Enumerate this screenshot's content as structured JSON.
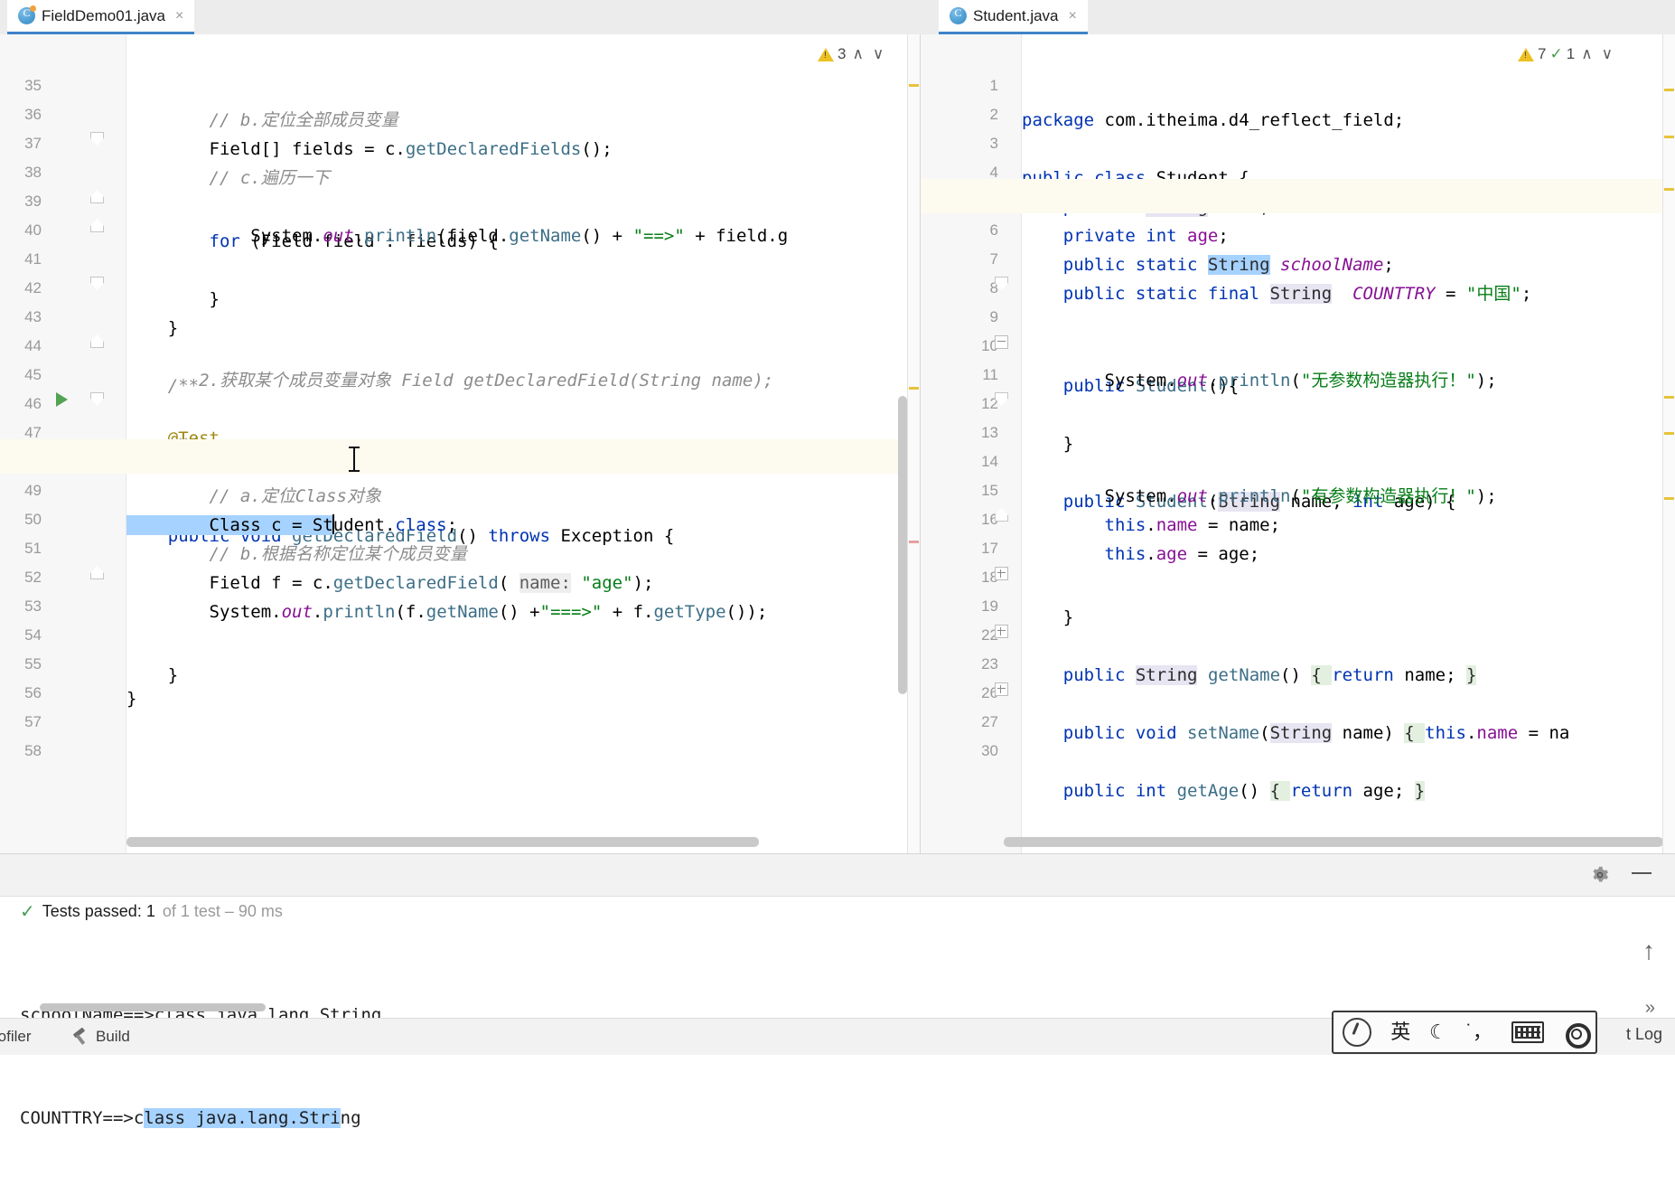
{
  "window": {
    "app": "IntelliJ IDEA"
  },
  "tabs": {
    "left": {
      "name": "FieldDemo01.java",
      "close": "×",
      "icon": "java-class-icon"
    },
    "right": {
      "name": "Student.java",
      "close": "×",
      "icon": "java-class-icon"
    }
  },
  "inspections": {
    "left": {
      "warning_count": "3",
      "prev": "∧",
      "next": "∨"
    },
    "right": {
      "warning_count": "7",
      "typo_count": "1",
      "prev": "∧",
      "next": "∨"
    }
  },
  "left_editor": {
    "file": "FieldDemo01.java",
    "lines": [
      {
        "n": "35",
        "text": "        // b.定位全部成员变量"
      },
      {
        "n": "36",
        "text": "        Field[] fields = c.getDeclaredFields();"
      },
      {
        "n": "37",
        "text": "        // c.遍历一下"
      },
      {
        "n": "38",
        "text": "        for (Field field : fields) {"
      },
      {
        "n": "39",
        "text": "            System.out.println(field.getName() + \"==>\" + field.g"
      },
      {
        "n": "40",
        "text": "        }"
      },
      {
        "n": "41",
        "text": "    }"
      },
      {
        "n": "42",
        "text": ""
      },
      {
        "n": "43",
        "text": "    /**"
      },
      {
        "n": "44",
        "text": "       2.获取某个成员变量对象 Field getDeclaredField(String name);"
      },
      {
        "n": "45",
        "text": "     */"
      },
      {
        "n": "46",
        "text": "    @Test"
      },
      {
        "n": "47",
        "text": "    public void getDeclaredField() throws Exception {"
      },
      {
        "n": "48",
        "text": "        // a.定位Class对象"
      },
      {
        "n": "49",
        "text": "        Class c = Student.class;"
      },
      {
        "n": "50",
        "text": "        // b.根据名称定位某个成员变量"
      },
      {
        "n": "51",
        "text": "        Field f = c.getDeclaredField( name: \"age\");"
      },
      {
        "n": "52",
        "text": "        System.out.println(f.getName() +\"===>\" + f.getType());"
      },
      {
        "n": "53",
        "text": "    }"
      },
      {
        "n": "54",
        "text": ""
      },
      {
        "n": "55",
        "text": "}"
      },
      {
        "n": "56",
        "text": ""
      },
      {
        "n": "57",
        "text": ""
      },
      {
        "n": "58",
        "text": ""
      }
    ]
  },
  "right_editor": {
    "file": "Student.java",
    "lines": [
      {
        "n": "1",
        "text": "package com.itheima.d4_reflect_field;"
      },
      {
        "n": "2",
        "text": ""
      },
      {
        "n": "3",
        "text": "public class Student {"
      },
      {
        "n": "4",
        "text": "    private String name;"
      },
      {
        "n": "5",
        "text": "    private int age;"
      },
      {
        "n": "6",
        "text": "    public static String schoolName;"
      },
      {
        "n": "7",
        "text": "    public static final String  COUNTTRY = \"中国\";"
      },
      {
        "n": "8",
        "text": ""
      },
      {
        "n": "9",
        "text": "    public Student(){"
      },
      {
        "n": "10",
        "text": "        System.out.println(\"无参数构造器执行！\");"
      },
      {
        "n": "11",
        "text": "    }"
      },
      {
        "n": "12",
        "text": ""
      },
      {
        "n": "13",
        "text": "    public Student(String name, int age) {"
      },
      {
        "n": "14",
        "text": "        System.out.println(\"有参数构造器执行！\");"
      },
      {
        "n": "15",
        "text": "        this.name = name;"
      },
      {
        "n": "16",
        "text": "        this.age = age;"
      },
      {
        "n": "17",
        "text": "    }"
      },
      {
        "n": "18",
        "text": ""
      },
      {
        "n": "19",
        "text": "    public String getName() { return name; }"
      },
      {
        "n": "22",
        "text": ""
      },
      {
        "n": "23",
        "text": "    public void setName(String name) { this.name = na"
      },
      {
        "n": "26",
        "text": ""
      },
      {
        "n": "27",
        "text": "    public int getAge() { return age; }"
      },
      {
        "n": "30",
        "text": ""
      }
    ]
  },
  "run_panel": {
    "test_status": {
      "icon": "check-icon",
      "primary": "Tests passed: 1",
      "secondary": "of 1 test – 90 ms"
    },
    "console": [
      "schoolName==>class java.lang.String",
      "COUNTTRY==>class java.lang.String"
    ],
    "toolbar": {
      "settings_icon": "gear-icon",
      "minimize_icon": "minimize-icon",
      "scroll_up_icon": "↑",
      "expand_icon": "»"
    }
  },
  "status_bar": {
    "profiler": "rofiler",
    "build": "Build",
    "build_icon": "hammer-icon",
    "log": "t Log"
  },
  "ime_toolbar": {
    "logo": "sogou-logo-icon",
    "mode": "英",
    "moon": "☾",
    "punct": "˙，",
    "keyboard": "keyboard-icon",
    "settings": "gear-icon"
  },
  "colors": {
    "accent": "#4083c9",
    "keyword": "#0033b3",
    "string": "#067d17",
    "comment": "#8c8c8c",
    "annotation": "#9e880d",
    "field": "#871094",
    "selection": "#a6d2ff",
    "warning": "#edc023",
    "pass": "#499c54"
  }
}
